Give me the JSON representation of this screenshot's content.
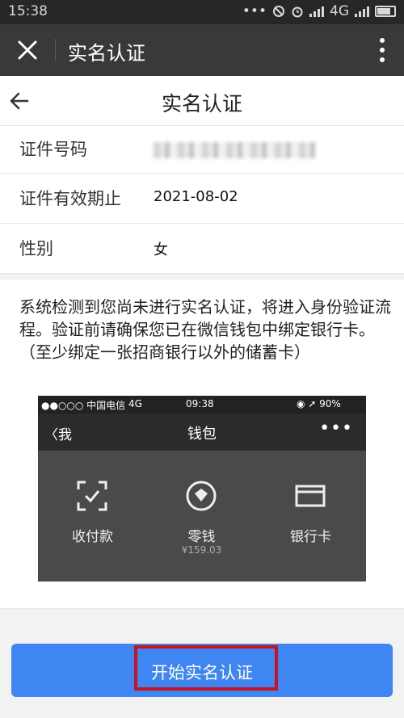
{
  "status_bar": {
    "time": "15:38",
    "network": "4G"
  },
  "window": {
    "title": "实名认证"
  },
  "nav": {
    "title": "实名认证"
  },
  "rows": [
    {
      "label": "证件号码",
      "value": ""
    },
    {
      "label": "证件有效期止",
      "value": "2021-08-02"
    },
    {
      "label": "性别",
      "value": "女"
    }
  ],
  "notice": {
    "text": "系统检测到您尚未进行实名认证，将进入身份验证流程。验证前请确保您已在微信钱包中绑定银行卡。（至少绑定一张招商银行以外的储蓄卡）"
  },
  "wallet_screenshot": {
    "carrier": "●●○○○ 中国电信",
    "network": "4G",
    "time": "09:38",
    "battery": "◉ ➚ 90%",
    "back_label": "〈我",
    "title": "钱包",
    "more": "•••",
    "tiles": [
      {
        "label": "收付款",
        "sub": ""
      },
      {
        "label": "零钱",
        "sub": "¥159.03"
      },
      {
        "label": "银行卡",
        "sub": ""
      }
    ]
  },
  "action": {
    "button_label": "开始实名认证"
  },
  "colors": {
    "accent": "#3f86f2",
    "highlight": "#c8121d",
    "titlebar": "#393939"
  },
  "icons": {
    "close": "close-icon",
    "more": "more-vertical-icon",
    "back": "arrow-left-icon"
  }
}
